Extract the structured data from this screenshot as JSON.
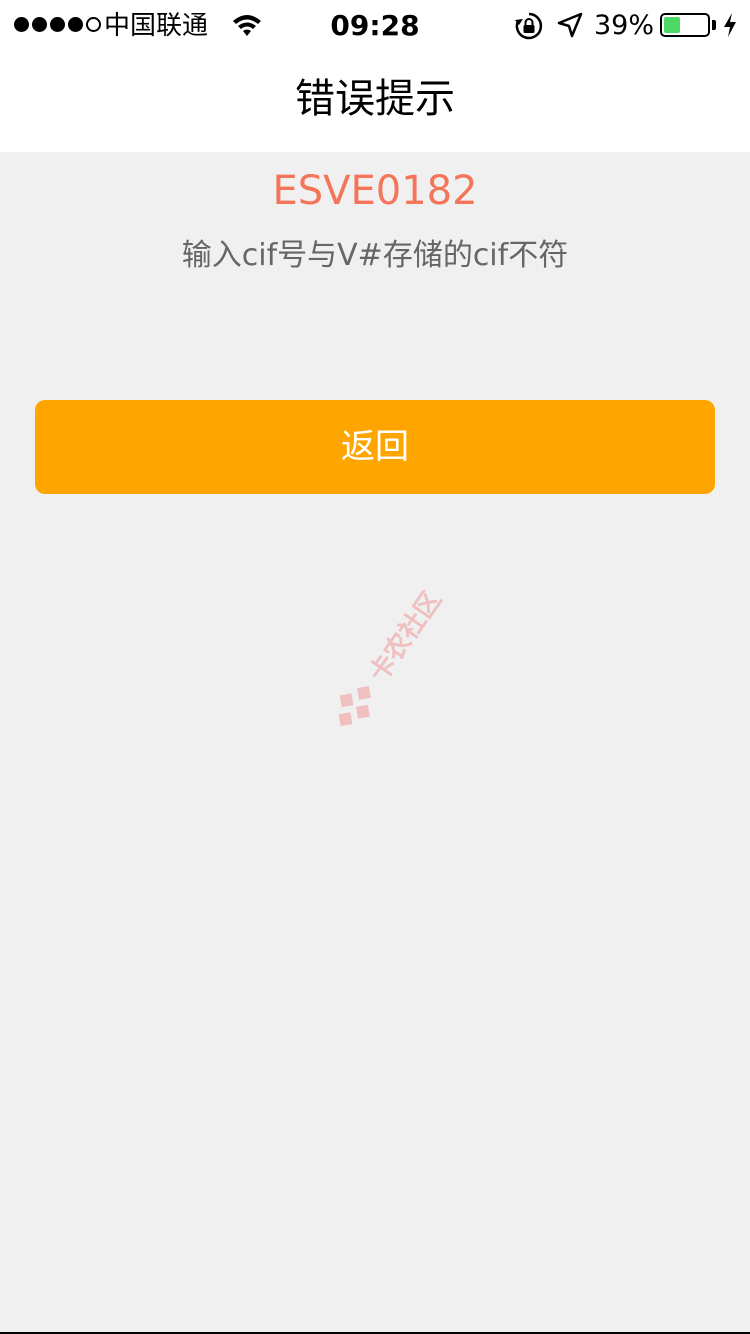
{
  "status_bar": {
    "carrier": "中国联通",
    "time": "09:28",
    "battery_percent_text": "39%",
    "battery_level": 0.39,
    "signal_bars_filled": 4,
    "signal_bars_total": 5
  },
  "nav": {
    "title": "错误提示"
  },
  "error": {
    "code": "ESVE0182",
    "message": "输入cif号与V#存储的cif不符"
  },
  "actions": {
    "back_label": "返回"
  },
  "watermark": {
    "text": "卡农社区"
  },
  "colors": {
    "accent": "#ffa500",
    "error_code": "#f47559",
    "background": "#f0f0f0"
  }
}
